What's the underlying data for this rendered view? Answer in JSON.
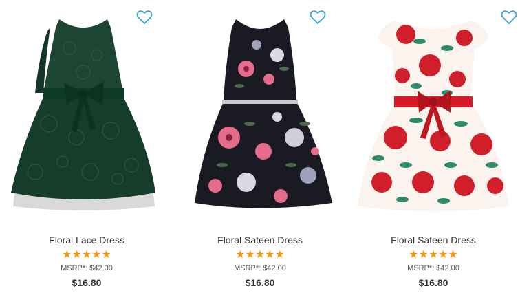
{
  "colors": {
    "heart": "#3aa6d8",
    "star": "#f39c12"
  },
  "products": [
    {
      "name": "Floral Lace Dress",
      "rating_stars": "★★★★★",
      "rating": 5,
      "msrp": "MSRP*: $42.00",
      "price": "$16.80",
      "wishlist_icon": "heart-outline-icon",
      "image": "green-lace-dress"
    },
    {
      "name": "Floral Sateen Dress",
      "rating_stars": "★★★★★",
      "rating": 5,
      "msrp": "MSRP*: $42.00",
      "price": "$16.80",
      "wishlist_icon": "heart-outline-icon",
      "image": "black-floral-dress"
    },
    {
      "name": "Floral Sateen Dress",
      "rating_stars": "★★★★★",
      "rating": 5,
      "msrp": "MSRP*: $42.00",
      "price": "$16.80",
      "wishlist_icon": "heart-outline-icon",
      "image": "red-floral-dress"
    }
  ]
}
